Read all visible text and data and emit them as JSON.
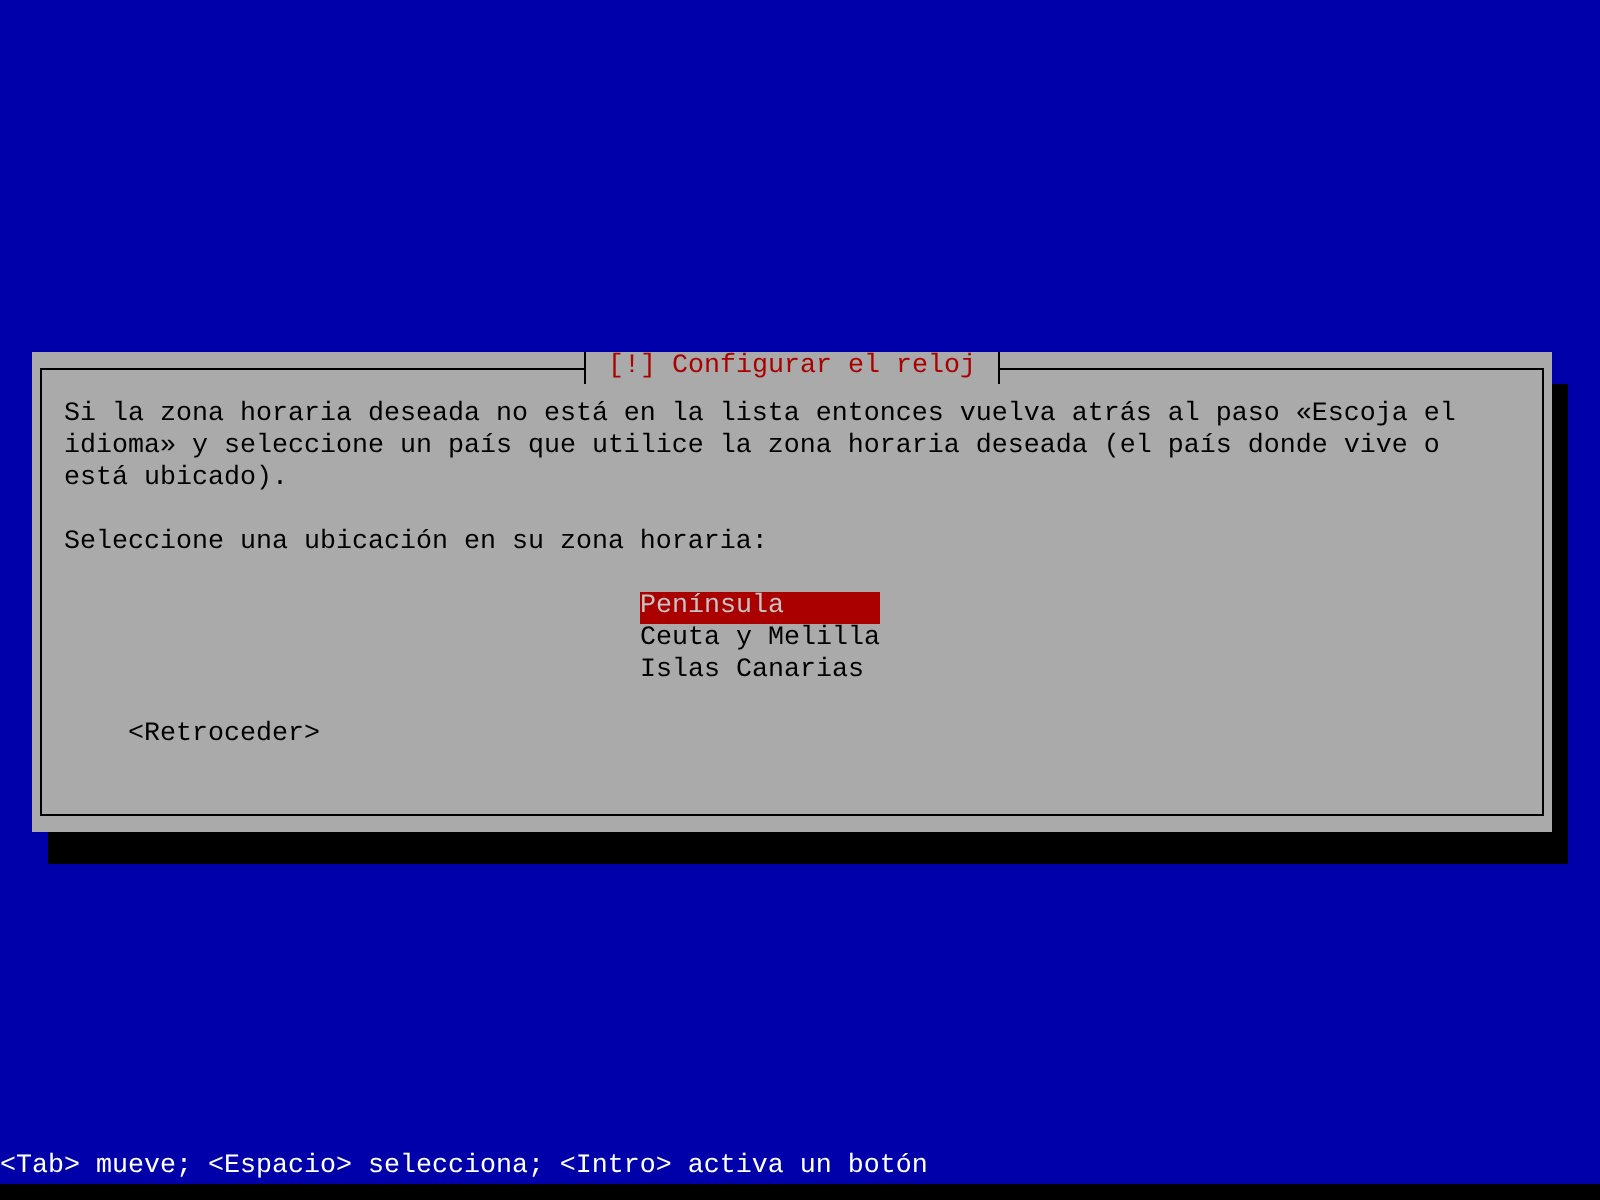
{
  "dialog": {
    "title": "[!] Configurar el reloj",
    "message": "Si la zona horaria deseada no está en la lista entonces vuelva atrás al paso «Escoja el idioma» y seleccione un país que utilice la zona horaria deseada (el país donde vive o está ubicado).",
    "prompt": "Seleccione una ubicación en su zona horaria:",
    "options": [
      {
        "label": "Península",
        "selected": true
      },
      {
        "label": "Ceuta y Melilla",
        "selected": false
      },
      {
        "label": "Islas Canarias",
        "selected": false
      }
    ],
    "back_button": "<Retroceder>"
  },
  "help_line": "<Tab> mueve; <Espacio> selecciona; <Intro> activa un botón"
}
